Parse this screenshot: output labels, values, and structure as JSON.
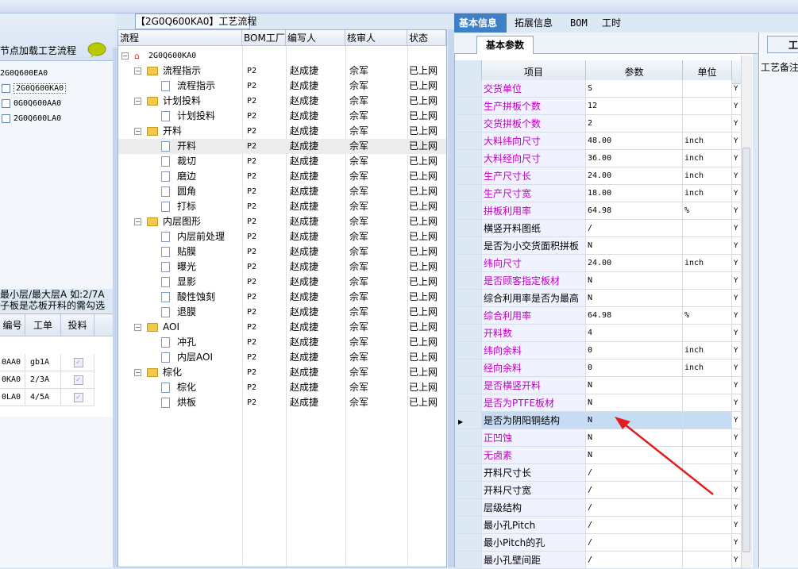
{
  "left": {
    "reload_label": "节点加载工艺流程",
    "root_item": "2G0Q600EA0",
    "items": [
      {
        "label": "2G0Q600KA0",
        "selected": true
      },
      {
        "label": "0G0Q600AA0",
        "selected": false
      },
      {
        "label": "2G0Q600LA0",
        "selected": false
      }
    ],
    "note_line1": "最小层/最大层A 如:2/7A",
    "note_line2": "子板是芯板开料的需勾选",
    "grid_headers": [
      "编号",
      "工单",
      "投料"
    ],
    "grid_rows": [
      {
        "code": "0AA0",
        "order": "gb1A"
      },
      {
        "code": "0KA0",
        "order": "2/3A"
      },
      {
        "code": "0LA0",
        "order": "4/5A"
      }
    ]
  },
  "middle": {
    "title": "【2G0Q600KA0】工艺流程",
    "headers": [
      "流程",
      "BOM工厂",
      "编写人",
      "核审人",
      "状态"
    ],
    "root": "2G0Q600KA0",
    "rows": [
      {
        "name": "流程指示",
        "level": 1,
        "factory": "P2",
        "writer": "赵成捷",
        "reviewer": "佘军",
        "status": "已上网"
      },
      {
        "name": "流程指示",
        "level": 2,
        "factory": "P2",
        "writer": "赵成捷",
        "reviewer": "佘军",
        "status": "已上网"
      },
      {
        "name": "计划投料",
        "level": 1,
        "factory": "P2",
        "writer": "赵成捷",
        "reviewer": "佘军",
        "status": "已上网"
      },
      {
        "name": "计划投料",
        "level": 2,
        "factory": "P2",
        "writer": "赵成捷",
        "reviewer": "佘军",
        "status": "已上网"
      },
      {
        "name": "开料",
        "level": 1,
        "factory": "P2",
        "writer": "赵成捷",
        "reviewer": "佘军",
        "status": "已上网"
      },
      {
        "name": "开料",
        "level": 2,
        "factory": "P2",
        "writer": "赵成捷",
        "reviewer": "佘军",
        "status": "已上网"
      },
      {
        "name": "裁切",
        "level": 2,
        "factory": "P2",
        "writer": "赵成捷",
        "reviewer": "佘军",
        "status": "已上网"
      },
      {
        "name": "磨边",
        "level": 2,
        "factory": "P2",
        "writer": "赵成捷",
        "reviewer": "佘军",
        "status": "已上网"
      },
      {
        "name": "圆角",
        "level": 2,
        "factory": "P2",
        "writer": "赵成捷",
        "reviewer": "佘军",
        "status": "已上网"
      },
      {
        "name": "打标",
        "level": 2,
        "factory": "P2",
        "writer": "赵成捷",
        "reviewer": "佘军",
        "status": "已上网"
      },
      {
        "name": "内层图形",
        "level": 1,
        "factory": "P2",
        "writer": "赵成捷",
        "reviewer": "佘军",
        "status": "已上网"
      },
      {
        "name": "内层前处理",
        "level": 2,
        "factory": "P2",
        "writer": "赵成捷",
        "reviewer": "佘军",
        "status": "已上网"
      },
      {
        "name": "贴膜",
        "level": 2,
        "factory": "P2",
        "writer": "赵成捷",
        "reviewer": "佘军",
        "status": "已上网"
      },
      {
        "name": "曝光",
        "level": 2,
        "factory": "P2",
        "writer": "赵成捷",
        "reviewer": "佘军",
        "status": "已上网"
      },
      {
        "name": "显影",
        "level": 2,
        "factory": "P2",
        "writer": "赵成捷",
        "reviewer": "佘军",
        "status": "已上网"
      },
      {
        "name": "酸性蚀刻",
        "level": 2,
        "factory": "P2",
        "writer": "赵成捷",
        "reviewer": "佘军",
        "status": "已上网"
      },
      {
        "name": "退膜",
        "level": 2,
        "factory": "P2",
        "writer": "赵成捷",
        "reviewer": "佘军",
        "status": "已上网"
      },
      {
        "name": "AOI",
        "level": 1,
        "factory": "P2",
        "writer": "赵成捷",
        "reviewer": "佘军",
        "status": "已上网"
      },
      {
        "name": "冲孔",
        "level": 2,
        "factory": "P2",
        "writer": "赵成捷",
        "reviewer": "佘军",
        "status": "已上网"
      },
      {
        "name": "内层AOI",
        "level": 2,
        "factory": "P2",
        "writer": "赵成捷",
        "reviewer": "佘军",
        "status": "已上网"
      },
      {
        "name": "棕化",
        "level": 1,
        "factory": "P2",
        "writer": "赵成捷",
        "reviewer": "佘军",
        "status": "已上网"
      },
      {
        "name": "棕化",
        "level": 2,
        "factory": "P2",
        "writer": "赵成捷",
        "reviewer": "佘军",
        "status": "已上网"
      },
      {
        "name": "烘板",
        "level": 2,
        "factory": "P2",
        "writer": "赵成捷",
        "reviewer": "佘军",
        "status": "已上网"
      }
    ]
  },
  "right": {
    "tabs": [
      "基本信息",
      "拓展信息",
      "BOM",
      "工时"
    ],
    "subtab": "基本参数",
    "headers": [
      "项目",
      "参数",
      "单位"
    ],
    "rows": [
      {
        "name": "交货单位",
        "value": "S",
        "unit": "",
        "flag": "Y",
        "pink": true
      },
      {
        "name": "生产拼板个数",
        "value": "12",
        "unit": "",
        "flag": "Y",
        "pink": true
      },
      {
        "name": "交货拼板个数",
        "value": "2",
        "unit": "",
        "flag": "Y",
        "pink": true
      },
      {
        "name": "大料纬向尺寸",
        "value": "48.00",
        "unit": "inch",
        "flag": "Y",
        "pink": true
      },
      {
        "name": "大料经向尺寸",
        "value": "36.00",
        "unit": "inch",
        "flag": "Y",
        "pink": true
      },
      {
        "name": "生产尺寸长",
        "value": "24.00",
        "unit": "inch",
        "flag": "Y",
        "pink": true
      },
      {
        "name": "生产尺寸宽",
        "value": "18.00",
        "unit": "inch",
        "flag": "Y",
        "pink": true
      },
      {
        "name": "拼板利用率",
        "value": "64.98",
        "unit": "%",
        "flag": "Y",
        "pink": true
      },
      {
        "name": "横竖开料图纸",
        "value": "/",
        "unit": "",
        "flag": "Y",
        "pink": false
      },
      {
        "name": "是否为小交货面积拼板",
        "value": "N",
        "unit": "",
        "flag": "Y",
        "pink": false
      },
      {
        "name": "纬向尺寸",
        "value": "24.00",
        "unit": "inch",
        "flag": "Y",
        "pink": true
      },
      {
        "name": "是否顾客指定板材",
        "value": "N",
        "unit": "",
        "flag": "Y",
        "pink": true
      },
      {
        "name": "综合利用率是否为最高",
        "value": "N",
        "unit": "",
        "flag": "Y",
        "pink": false
      },
      {
        "name": "综合利用率",
        "value": "64.98",
        "unit": "%",
        "flag": "Y",
        "pink": true
      },
      {
        "name": "开料数",
        "value": "4",
        "unit": "",
        "flag": "Y",
        "pink": true
      },
      {
        "name": "纬向余料",
        "value": "0",
        "unit": "inch",
        "flag": "Y",
        "pink": true
      },
      {
        "name": "经向余料",
        "value": "0",
        "unit": "inch",
        "flag": "Y",
        "pink": true
      },
      {
        "name": "是否横竖开料",
        "value": "N",
        "unit": "",
        "flag": "Y",
        "pink": true
      },
      {
        "name": "是否为PTFE板材",
        "value": "N",
        "unit": "",
        "flag": "Y",
        "pink": true
      },
      {
        "name": "是否为阴阳铜结构",
        "value": "N",
        "unit": "",
        "flag": "Y",
        "pink": false,
        "current": true
      },
      {
        "name": "正凹蚀",
        "value": "N",
        "unit": "",
        "flag": "Y",
        "pink": true
      },
      {
        "name": "无卤素",
        "value": "N",
        "unit": "",
        "flag": "Y",
        "pink": true
      },
      {
        "name": "开料尺寸长",
        "value": "/",
        "unit": "",
        "flag": "Y",
        "pink": false
      },
      {
        "name": "开料尺寸宽",
        "value": "/",
        "unit": "",
        "flag": "Y",
        "pink": false
      },
      {
        "name": "层级结构",
        "value": "/",
        "unit": "",
        "flag": "Y",
        "pink": false
      },
      {
        "name": "最小孔Pitch",
        "value": "/",
        "unit": "",
        "flag": "Y",
        "pink": false
      },
      {
        "name": "最小Pitch的孔",
        "value": "/",
        "unit": "",
        "flag": "Y",
        "pink": false
      },
      {
        "name": "最小孔壁间距",
        "value": "/",
        "unit": "",
        "flag": "Y",
        "pink": false
      }
    ]
  },
  "far_right": {
    "tab": "工",
    "label": "工艺备注"
  },
  "colors": {
    "accent": "#3f7fc7",
    "pink_label": "#c000c0",
    "arrow": "#e02020"
  }
}
